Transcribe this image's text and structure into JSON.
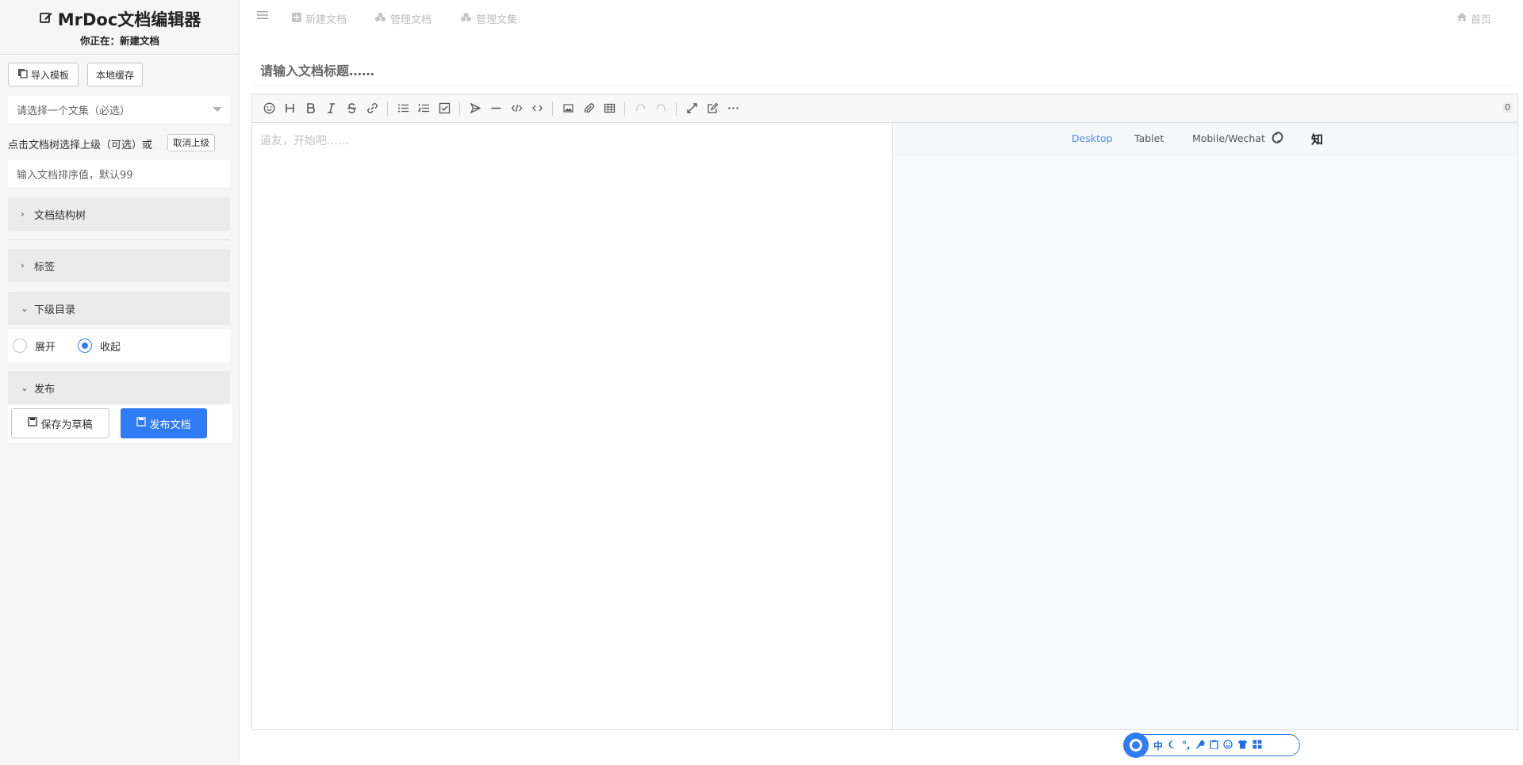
{
  "sidebar": {
    "brand_title": "MrDoc文档编辑器",
    "brand_sub": "你正在：新建文档",
    "import_template": "导入模板",
    "local_cache": "本地缓存",
    "collection_placeholder": "请选择一个文集（必选）",
    "parent_hint": "点击文档树选择上级（可选）或",
    "cancel_parent": "取消上级",
    "sort_placeholder": "输入文档排序值，默认99",
    "doc_tree": "文档结构树",
    "tags": "标签",
    "sub_dir": "下级目录",
    "expand": "展开",
    "collapse": "收起",
    "publish_section": "发布",
    "save_draft": "保存为草稿",
    "publish_doc": "发布文档"
  },
  "topbar": {
    "new_doc": "新建文档",
    "manage_docs": "管理文档",
    "manage_collections": "管理文集",
    "home": "首页"
  },
  "editor": {
    "title_placeholder": "请输入文档标题……",
    "body_placeholder": "道友，开始吧……",
    "char_count": "0",
    "preview_modes": [
      "Desktop",
      "Tablet",
      "Mobile/Wechat"
    ],
    "zhi_label": "知"
  },
  "floatbar": {
    "zh": "中",
    "dots": "°,"
  },
  "colors": {
    "accent": "#2f7cf6",
    "sidebar_bg": "#f6f6f6"
  }
}
